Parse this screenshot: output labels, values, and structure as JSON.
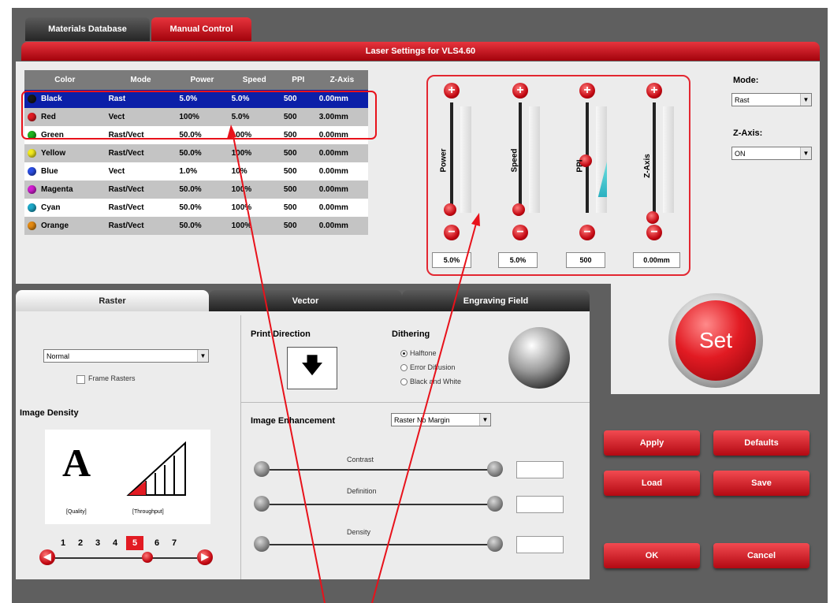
{
  "tabs": {
    "materials_database": "Materials Database",
    "manual_control": "Manual Control"
  },
  "title": "Laser Settings for VLS4.60",
  "table": {
    "headers": [
      "Color",
      "Mode",
      "Power",
      "Speed",
      "PPI",
      "Z-Axis"
    ],
    "rows": [
      {
        "color": "Black",
        "mode": "Rast",
        "power": "5.0%",
        "speed": "5.0%",
        "ppi": "500",
        "zaxis": "0.00mm",
        "dot": "#1a1a1a"
      },
      {
        "color": "Red",
        "mode": "Vect",
        "power": "100%",
        "speed": "5.0%",
        "ppi": "500",
        "zaxis": "3.00mm",
        "dot": "#e21b23"
      },
      {
        "color": "Green",
        "mode": "Rast/Vect",
        "power": "50.0%",
        "speed": "100%",
        "ppi": "500",
        "zaxis": "0.00mm",
        "dot": "#1fb41f"
      },
      {
        "color": "Yellow",
        "mode": "Rast/Vect",
        "power": "50.0%",
        "speed": "100%",
        "ppi": "500",
        "zaxis": "0.00mm",
        "dot": "#f2ea1e"
      },
      {
        "color": "Blue",
        "mode": "Vect",
        "power": "1.0%",
        "speed": "10%",
        "ppi": "500",
        "zaxis": "0.00mm",
        "dot": "#2c4fe6"
      },
      {
        "color": "Magenta",
        "mode": "Rast/Vect",
        "power": "50.0%",
        "speed": "100%",
        "ppi": "500",
        "zaxis": "0.00mm",
        "dot": "#d21ed2"
      },
      {
        "color": "Cyan",
        "mode": "Rast/Vect",
        "power": "50.0%",
        "speed": "100%",
        "ppi": "500",
        "zaxis": "0.00mm",
        "dot": "#1ea9c9"
      },
      {
        "color": "Orange",
        "mode": "Rast/Vect",
        "power": "50.0%",
        "speed": "100%",
        "ppi": "500",
        "zaxis": "0.00mm",
        "dot": "#e48a12"
      }
    ]
  },
  "sliders": {
    "power": {
      "label": "Power",
      "value": "5.0%"
    },
    "speed": {
      "label": "Speed",
      "value": "5.0%"
    },
    "ppi": {
      "label": "PPI",
      "value": "500"
    },
    "zaxis": {
      "label": "Z-Axis",
      "value": "0.00mm"
    }
  },
  "mode": {
    "label": "Mode:",
    "value": "Rast"
  },
  "zaxis_select": {
    "label": "Z-Axis:",
    "value": "ON"
  },
  "set_button": "Set",
  "lower_tabs": {
    "raster": "Raster",
    "vector": "Vector",
    "engraving_field": "Engraving Field"
  },
  "raster": {
    "dropdown": "Normal",
    "frame_rasters": "Frame Rasters",
    "image_density": "Image Density",
    "quality_label": "[Quality]",
    "throughput_label": "[Throughput]",
    "density_numbers": [
      "1",
      "2",
      "3",
      "4",
      "5",
      "6",
      "7"
    ],
    "selected_density": "5"
  },
  "print_direction": "Print Direction",
  "dithering": {
    "title": "Dithering",
    "options": [
      "Halftone",
      "Error Diffusion",
      "Black and White"
    ]
  },
  "image_enhancement": {
    "label": "Image Enhancement",
    "select": "Raster No Margin"
  },
  "enhancement_sliders": [
    "Contrast",
    "Definition",
    "Density"
  ],
  "buttons": {
    "apply": "Apply",
    "defaults": "Defaults",
    "load": "Load",
    "save": "Save",
    "ok": "OK",
    "cancel": "Cancel"
  },
  "colors": {
    "accent_red": "#e21b23",
    "highlight_blue": "#0b1fa8",
    "annotation": "#e8121b"
  }
}
